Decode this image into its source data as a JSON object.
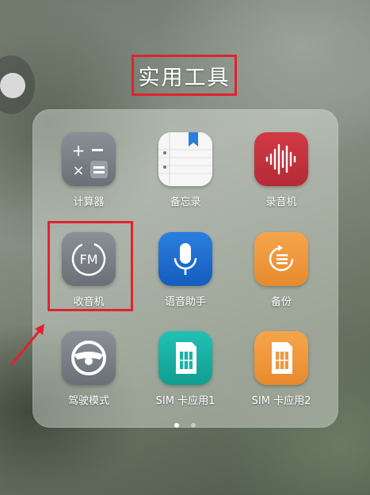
{
  "folder": {
    "title": "实用工具",
    "apps": [
      {
        "label": "计算器",
        "icon": "calculator-icon",
        "color": "#7b7f86"
      },
      {
        "label": "备忘录",
        "icon": "notepad-icon",
        "color": "#f2f2f2"
      },
      {
        "label": "录音机",
        "icon": "recorder-icon",
        "color": "#c8323d"
      },
      {
        "label": "收音机",
        "icon": "fm-radio-icon",
        "color": "#7b7f86"
      },
      {
        "label": "语音助手",
        "icon": "microphone-icon",
        "color": "#1e6fd0"
      },
      {
        "label": "备份",
        "icon": "backup-icon",
        "color": "#f0973c"
      },
      {
        "label": "驾驶模式",
        "icon": "steering-wheel-icon",
        "color": "#7b7f86"
      },
      {
        "label": "SIM 卡应用1",
        "icon": "sim-card-icon",
        "color": "#1ab2a6"
      },
      {
        "label": "SIM 卡应用2",
        "icon": "sim-card-icon",
        "color": "#f0973c"
      }
    ],
    "page_indicator": {
      "pages": 2,
      "current": 1
    }
  },
  "colors": {
    "annotation_red": "#e0232e",
    "dot_active": "#ffffff",
    "dot_inactive": "#c8c8c8"
  }
}
